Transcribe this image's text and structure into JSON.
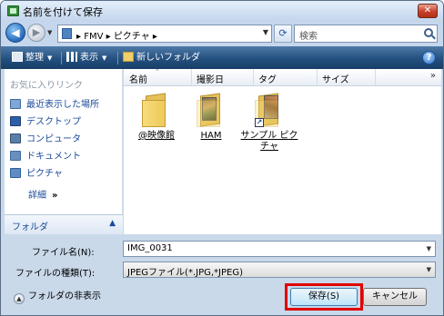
{
  "window": {
    "title": "名前を付けて保存",
    "close_label": "✕"
  },
  "nav": {
    "back_glyph": "◀",
    "forward_glyph": "▶",
    "address": "▸ FMV ▸ ピクチャ ▸",
    "search_placeholder": "検索"
  },
  "toolbar": {
    "organize_label": "整理",
    "view_label": "表示",
    "new_folder_label": "新しいフォルダ",
    "help_label": "?"
  },
  "sidebar": {
    "header": "お気に入りリンク",
    "items": [
      {
        "label": "最近表示した場所",
        "icon": "recent-places-icon"
      },
      {
        "label": "デスクトップ",
        "icon": "desktop-icon"
      },
      {
        "label": "コンピュータ",
        "icon": "computer-icon"
      },
      {
        "label": "ドキュメント",
        "icon": "documents-icon"
      },
      {
        "label": "ピクチャ",
        "icon": "pictures-icon"
      }
    ],
    "details_label": "詳細",
    "details_chevron": "»",
    "folders_label": "フォルダ",
    "folders_chevron": "▲"
  },
  "filelist": {
    "columns": [
      "名前",
      "撮影日",
      "タグ",
      "サイズ"
    ],
    "more_columns": "»",
    "items": [
      {
        "name": "@映像館",
        "type": "folder"
      },
      {
        "name": "HAM",
        "type": "photo-folder"
      },
      {
        "name": "サンプル ピクチャ",
        "type": "shortcut-folder"
      }
    ]
  },
  "form": {
    "filename_label": "ファイル名(N):",
    "filename_value": "IMG_0031",
    "filetype_label": "ファイルの種類(T):",
    "filetype_value": "JPEGファイル(*.JPG,*JPEG)"
  },
  "footer": {
    "hide_folders_label": "フォルダの非表示",
    "save_label": "保存(S)",
    "cancel_label": "キャンセル"
  },
  "colors": {
    "toolbar": "#24507f",
    "link": "#1a4a9a",
    "highlight": "#e00000",
    "close_button": "#c8402a"
  }
}
